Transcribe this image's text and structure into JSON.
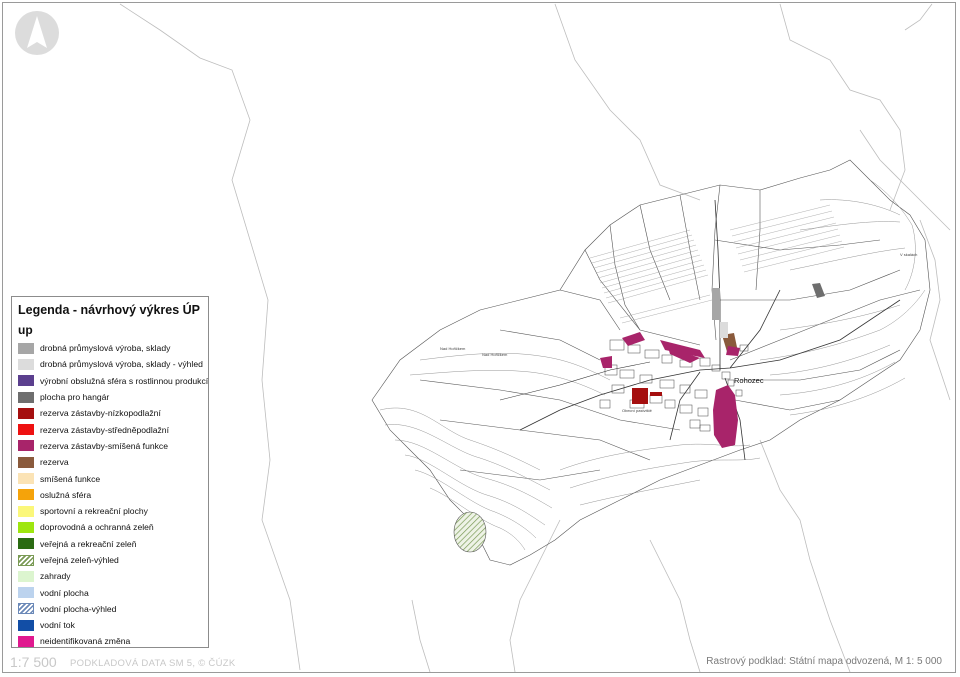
{
  "legend": {
    "title": "Legenda - návrhový výkres ÚP",
    "subtitle": "up",
    "items": [
      {
        "label": "drobná průmyslová výroba, sklady",
        "color": "#a6a6a6",
        "pattern": "solid"
      },
      {
        "label": "drobná průmyslová výroba, sklady - výhled",
        "color": "#dcdcdc",
        "pattern": "solid"
      },
      {
        "label": "výrobní obslužná sféra s rostlinnou produkcí",
        "color": "#5b3f8e",
        "pattern": "solid"
      },
      {
        "label": "plocha pro hangár",
        "color": "#6e6e6e",
        "pattern": "solid"
      },
      {
        "label": "rezerva zástavby-nízkopodlažní",
        "color": "#a50f0f",
        "pattern": "solid"
      },
      {
        "label": "rezerva zástavby-středněpodlažní",
        "color": "#ee1111",
        "pattern": "solid"
      },
      {
        "label": "rezerva zástavby-smíšená funkce",
        "color": "#a8246a",
        "pattern": "solid"
      },
      {
        "label": "rezerva",
        "color": "#8a5a3c",
        "pattern": "solid"
      },
      {
        "label": "smíšená funkce",
        "color": "#fbe3b5",
        "pattern": "solid"
      },
      {
        "label": "osluž­ná sféra",
        "color": "#f5a30a",
        "pattern": "solid"
      },
      {
        "label": "sportovní a rekreační plochy",
        "color": "#fbf77a",
        "pattern": "solid"
      },
      {
        "label": "doprovodná a ochranná zeleň",
        "color": "#9ee60f",
        "pattern": "solid"
      },
      {
        "label": "veřejná a rekreační zeleň",
        "color": "#2a6b12",
        "pattern": "solid"
      },
      {
        "label": "veřejná zeleň-výhled",
        "color": "#7a9a55",
        "pattern": "hatch"
      },
      {
        "label": "zahrady",
        "color": "#dcf5cf",
        "pattern": "solid"
      },
      {
        "label": "vodní plocha",
        "color": "#bcd3ee",
        "pattern": "solid"
      },
      {
        "label": "vodní plocha-výhled",
        "color": "#6b89b8",
        "pattern": "hatch"
      },
      {
        "label": "vodní tok",
        "color": "#124ea6",
        "pattern": "solid"
      },
      {
        "label": "neidentifikovaná změna",
        "color": "#e0198f",
        "pattern": "solid"
      }
    ]
  },
  "footer": {
    "scale": "1:7 500",
    "source": "PODKLADOVÁ DATA SM 5, © ČÚZK",
    "raster": "Rastrový podklad: Státní mapa odvozená, M 1: 5 000"
  },
  "map": {
    "town_label": "Rohozec",
    "north_icon": "north-arrow-icon",
    "zone_colors": {
      "smisena": "#a8246a",
      "rezerva": "#8a5a3c",
      "nizkopodlazni": "#a50f0f",
      "hangar": "#6e6e6e",
      "vyroba": "#a6a6a6",
      "vyhled": "#dcdcdc"
    }
  }
}
